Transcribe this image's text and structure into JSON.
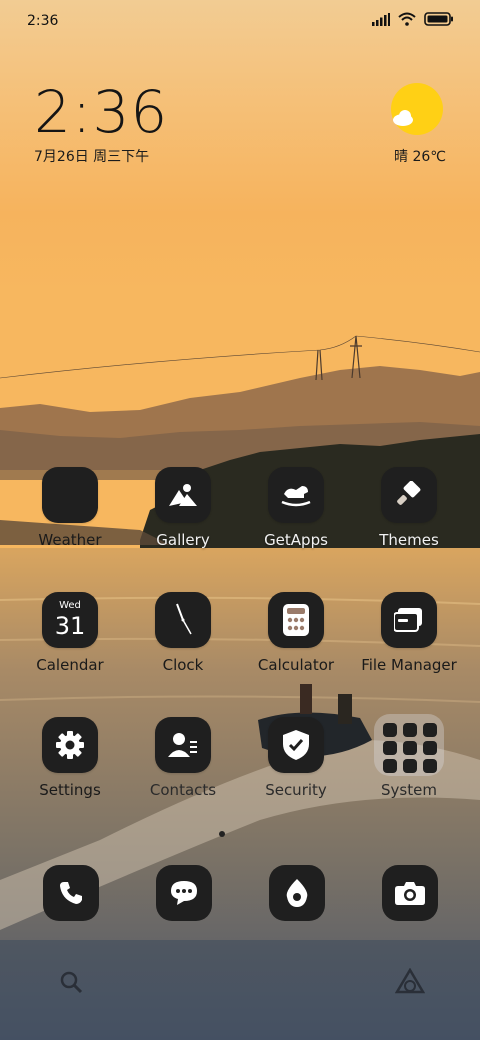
{
  "status_bar": {
    "time": "2:36"
  },
  "clock_widget": {
    "time": "2:36",
    "date": "7月26日 周三下午"
  },
  "weather_widget": {
    "text": "晴 26℃"
  },
  "apps": {
    "weather": "Weather",
    "gallery": "Gallery",
    "getapps": "GetApps",
    "themes": "Themes",
    "calendar": "Calendar",
    "calendar_day": "Wed",
    "calendar_date": "31",
    "clock": "Clock",
    "calculator": "Calculator",
    "file_manager": "File Manager",
    "settings": "Settings",
    "contacts": "Contacts",
    "security": "Security",
    "system": "System"
  },
  "dock": [
    "phone-icon",
    "messages-icon",
    "browser-icon",
    "camera-icon"
  ],
  "colors": {
    "sky_top": "#f3c684",
    "sky_mid": "#f5b35c",
    "water": "#8a7a62",
    "tile": "#1f1f1f",
    "sun": "#ffd015"
  }
}
